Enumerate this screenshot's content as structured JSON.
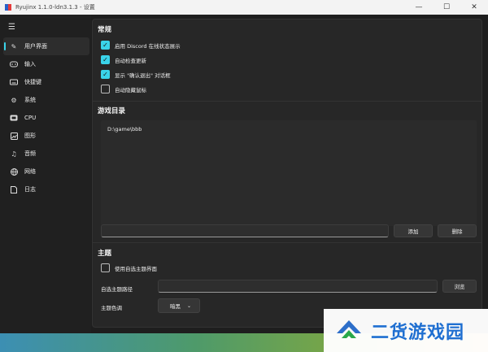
{
  "window": {
    "title": "Ryujinx 1.1.0-ldn3.1.3 - 设置",
    "controls": {
      "minimize": "—",
      "maximize": "☐",
      "close": "✕"
    }
  },
  "sidebar": {
    "items": [
      {
        "label": "用户界面",
        "icon": "pencil-icon",
        "active": true
      },
      {
        "label": "输入",
        "icon": "gamepad-icon"
      },
      {
        "label": "快捷键",
        "icon": "keyboard-icon"
      },
      {
        "label": "系统",
        "icon": "gear-icon"
      },
      {
        "label": "CPU",
        "icon": "cpu-icon"
      },
      {
        "label": "图形",
        "icon": "image-icon"
      },
      {
        "label": "音频",
        "icon": "music-icon"
      },
      {
        "label": "网络",
        "icon": "globe-icon"
      },
      {
        "label": "日志",
        "icon": "document-icon"
      }
    ]
  },
  "general": {
    "title": "常规",
    "options": [
      {
        "label": "启用 Discord 在线状态展示",
        "checked": true
      },
      {
        "label": "自动检查更新",
        "checked": true
      },
      {
        "label": "显示 \"确认退出\" 对话框",
        "checked": true
      },
      {
        "label": "自动隐藏鼠标",
        "checked": false
      }
    ]
  },
  "game_dirs": {
    "title": "游戏目录",
    "entries": [
      "D:\\game\\bbb"
    ],
    "new_path_value": "",
    "add_label": "添加",
    "remove_label": "删除"
  },
  "theme": {
    "title": "主题",
    "custom_theme_label": "使用自选主题界面",
    "custom_theme_checked": false,
    "theme_path_label": "自选主题路径",
    "theme_path_value": "",
    "browse_label": "浏览",
    "base_style_label": "主题色调",
    "base_style_value": "暗黑"
  },
  "watermark": {
    "text": "二货游戏园"
  },
  "colors": {
    "accent": "#3ad3e9",
    "watermark": "#1f6fd1"
  }
}
